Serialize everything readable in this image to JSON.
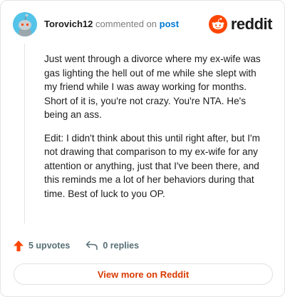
{
  "header": {
    "username": "Torovich12",
    "commented_on": "commented on",
    "post_link": "post",
    "brand": "reddit"
  },
  "comment": {
    "paragraphs": [
      "Just went through a divorce where my ex-wife was gas lighting the hell out of me while she slept with my friend while I was away working for months. Short of it is, you're not crazy. You're NTA. He's being an ass.",
      "Edit: I didn't think about this until right after, but I'm not drawing that comparison to my ex-wife for any attention or anything, just that I've been there, and this reminds me a lot of her behaviors during that time. Best of luck to you OP."
    ]
  },
  "actions": {
    "upvotes": "5 upvotes",
    "replies": "0 replies"
  },
  "footer": {
    "view_more": "View more on Reddit"
  },
  "colors": {
    "brand_orange": "#ff4500",
    "link_blue": "#0079d3",
    "view_more_text": "#d93a00",
    "avatar_bg": "#54c3e8"
  },
  "icons": [
    "avatar-snoo-icon",
    "reddit-logo-icon",
    "upvote-arrow-icon",
    "reply-arrow-icon"
  ]
}
